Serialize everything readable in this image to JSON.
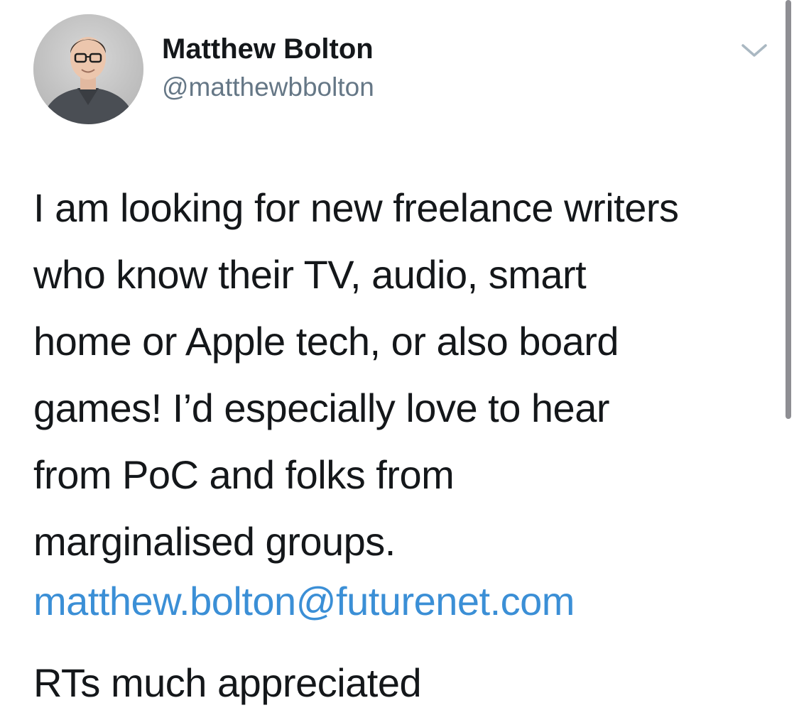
{
  "author": {
    "display_name": "Matthew Bolton",
    "handle": "@matthewbbolton"
  },
  "tweet": {
    "body_lines": [
      "I am looking for new freelance writers",
      "who know their TV, audio, smart",
      "home or Apple tech, or also board",
      "games! I’d especially love to hear",
      "from PoC and folks from",
      "marginalised groups."
    ],
    "email": "matthew.bolton@futurenet.com",
    "closing": "RTs much appreciated"
  },
  "icons": {
    "menu": "chevron-down-icon",
    "avatar": "profile-photo"
  },
  "colors": {
    "link": "#3b8fd6",
    "handle": "#657786",
    "text": "#14171a",
    "chevron": "#aab8c2"
  }
}
